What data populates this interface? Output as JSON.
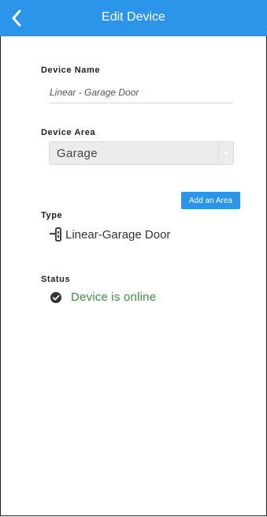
{
  "header": {
    "title": "Edit Device",
    "back_icon": "chevron-left-icon"
  },
  "form": {
    "device_name": {
      "label": "Device Name",
      "value": "Linear - Garage Door"
    },
    "device_area": {
      "label": "Device Area",
      "selected": "Garage"
    },
    "add_area_label": "Add an Area",
    "type": {
      "label": "Type",
      "value": "Linear-Garage Door",
      "icon": "garage-door-lock-icon"
    },
    "status": {
      "label": "Status",
      "value": "Device is online",
      "icon": "check-circle-icon",
      "color": "#3b8f3e"
    }
  },
  "colors": {
    "accent": "#2b95e9"
  }
}
